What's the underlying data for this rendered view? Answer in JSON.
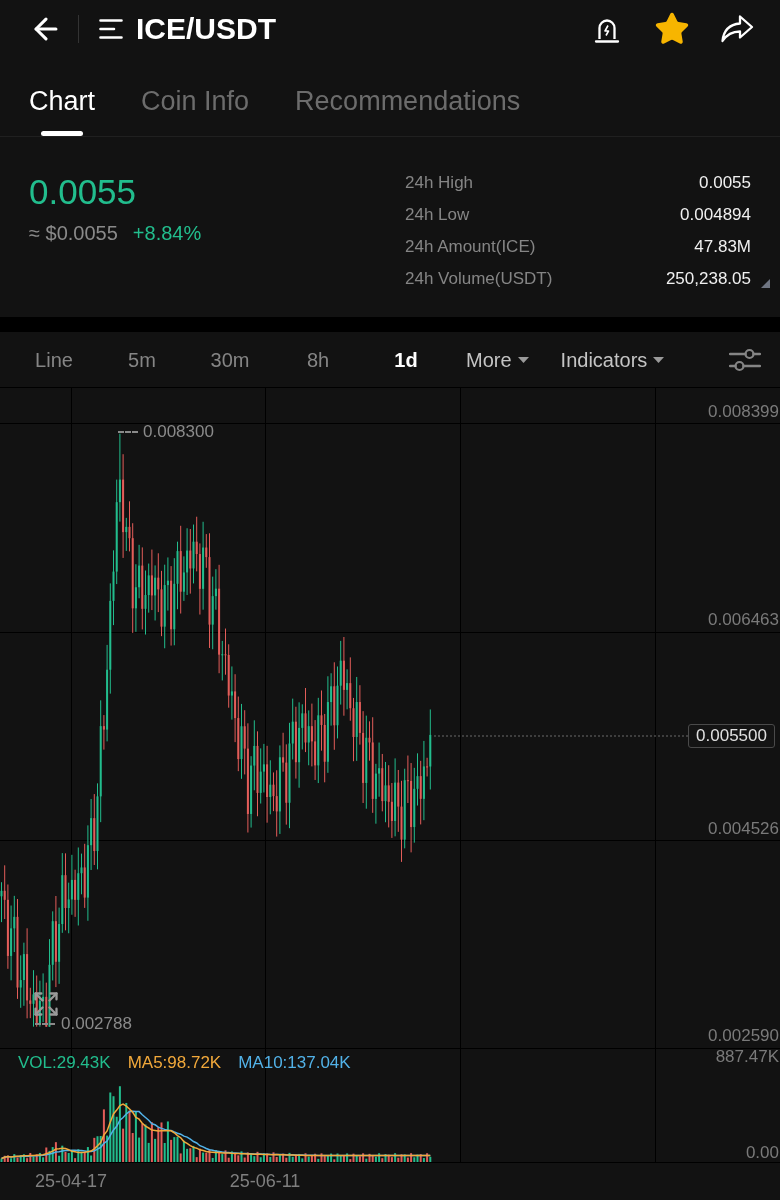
{
  "header": {
    "title": "ICE/USDT",
    "favorite": true
  },
  "tabs": [
    {
      "label": "Chart",
      "selected": true
    },
    {
      "label": "Coin Info",
      "selected": false
    },
    {
      "label": "Recommendations",
      "selected": false
    }
  ],
  "ticker": {
    "price": "0.0055",
    "fiat_price": "≈ $0.0055",
    "change": "+8.84%",
    "stats": [
      {
        "label": "24h High",
        "value": "0.0055",
        "expandable": false
      },
      {
        "label": "24h Low",
        "value": "0.004894",
        "expandable": false
      },
      {
        "label": "24h Amount(ICE)",
        "value": "47.83M",
        "expandable": false
      },
      {
        "label": "24h Volume(USDT)",
        "value": "250,238.05",
        "expandable": true
      }
    ]
  },
  "toolbar": {
    "intervals": [
      {
        "label": "Line",
        "selected": false
      },
      {
        "label": "5m",
        "selected": false
      },
      {
        "label": "30m",
        "selected": false
      },
      {
        "label": "8h",
        "selected": false
      },
      {
        "label": "1d",
        "selected": true
      }
    ],
    "menus": [
      {
        "label": "More"
      },
      {
        "label": "Indicators"
      }
    ]
  },
  "chart": {
    "y_axis": [
      "0.008399",
      "0.006463",
      "0.004526",
      "0.002590"
    ],
    "last_price": "0.005500",
    "high_marker": "0.008300",
    "low_marker": "0.002788",
    "volume_legend": [
      {
        "label": "VOL:29.43K",
        "color": "#22bd8d"
      },
      {
        "label": "MA5:98.72K",
        "color": "#f2a93b"
      },
      {
        "label": "MA10:137.04K",
        "color": "#52b2e8"
      }
    ],
    "volume_axis": [
      "887.47K",
      "0.00"
    ],
    "x_axis": [
      "25-04-17",
      "25-06-11"
    ]
  }
}
